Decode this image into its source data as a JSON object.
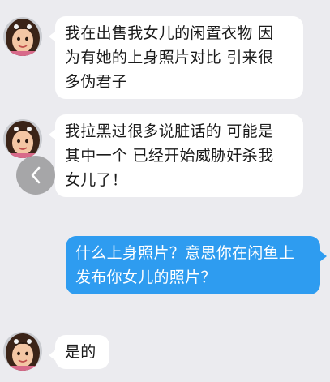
{
  "colors": {
    "background": "#ebebef",
    "incoming_bubble": "#ffffff",
    "outgoing_bubble": "#2e9cf0",
    "incoming_text": "#1a1a1a",
    "outgoing_text": "#ffffff"
  },
  "messages": [
    {
      "direction": "incoming",
      "avatar_icon": "girl-avatar",
      "lines": [
        "我在出售我女儿的闲置衣物 因",
        "为有她的上身照片对比 引来很",
        "多伪君子"
      ]
    },
    {
      "direction": "incoming",
      "avatar_icon": "girl-avatar",
      "lines": [
        "我拉黑过很多说脏话的 可能是",
        "其中一个 已经开始威胁奸杀我",
        "女儿了！"
      ]
    },
    {
      "direction": "outgoing",
      "lines": [
        "什么上身照片？意思你在闲鱼上",
        "发布你女儿的照片？"
      ]
    },
    {
      "direction": "incoming",
      "avatar_icon": "girl-avatar",
      "lines": [
        "是的"
      ]
    }
  ],
  "back_button": {
    "icon": "chevron-left-icon"
  }
}
